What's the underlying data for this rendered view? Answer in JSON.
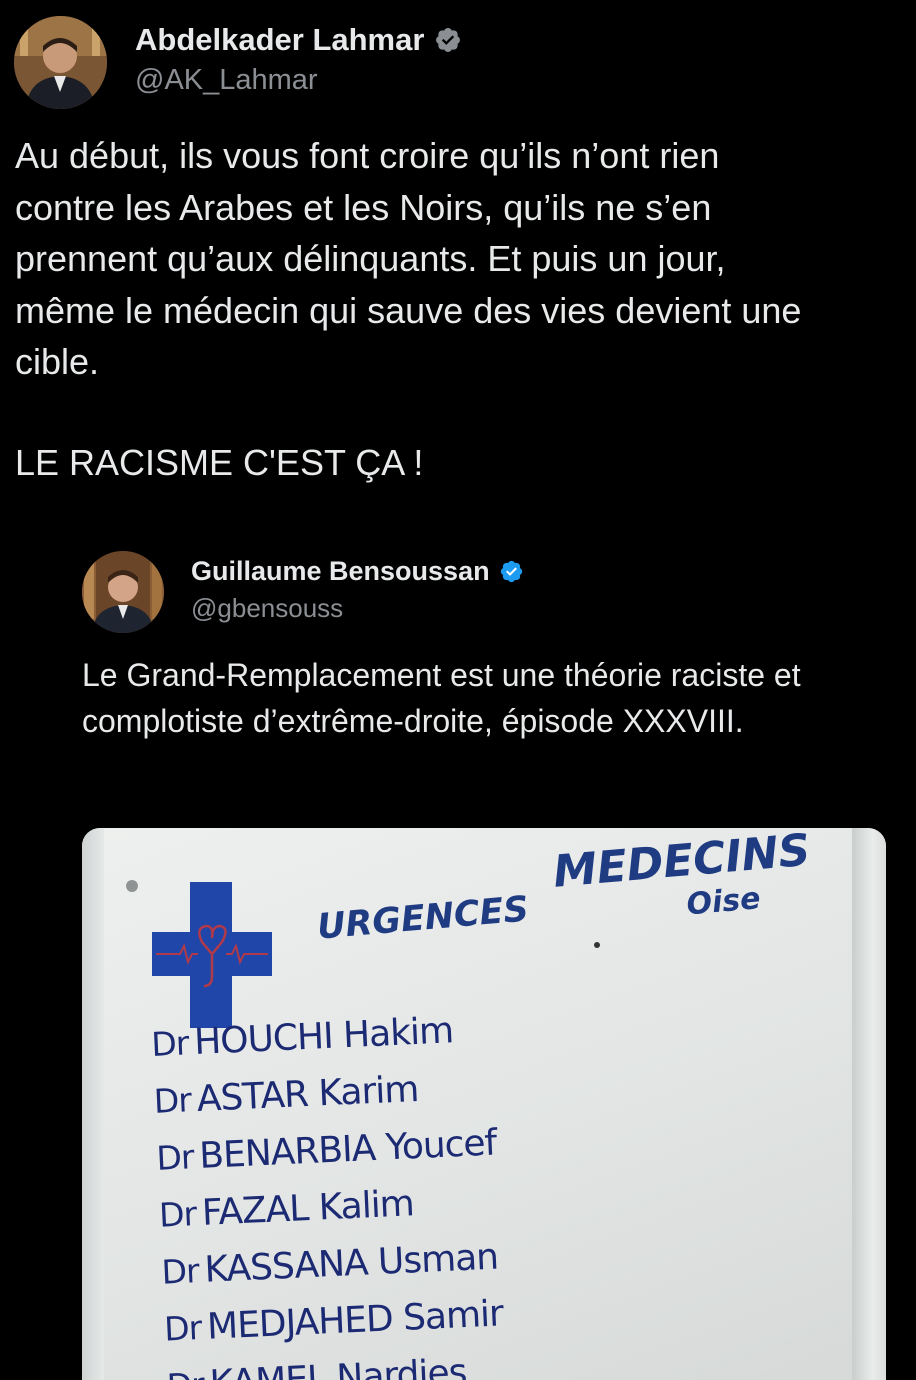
{
  "main_tweet": {
    "author_name": "Abdelkader Lahmar",
    "handle": "@AK_Lahmar",
    "verified": true,
    "text": "Au début, ils vous font croire qu’ils n’ont rien\ncontre les Arabes et les Noirs, qu’ils ne s’en\nprennent qu’aux délinquants. Et puis un jour,\nmême le médecin qui sauve des vies devient une\ncible.",
    "shout": "LE RACISME C'EST ÇA !"
  },
  "quoted_tweet": {
    "author_name": "Guillaume Bensoussan",
    "handle": "@gbensouss",
    "verified": true,
    "text": "Le Grand-Remplacement est une théorie raciste et complotiste d’extrême-droite, épisode XXXVIII."
  },
  "sign": {
    "title_left": "URGENCES",
    "title_right": "MEDECINS",
    "region": "Oise",
    "doctors": [
      {
        "prefix": "Dr",
        "name": "HOUCHI Hakim"
      },
      {
        "prefix": "Dr",
        "name": "ASTAR Karim"
      },
      {
        "prefix": "Dr",
        "name": "BENARBIA Youcef"
      },
      {
        "prefix": "Dr",
        "name": "FAZAL Kalim"
      },
      {
        "prefix": "Dr",
        "name": "KASSANA Usman"
      },
      {
        "prefix": "Dr",
        "name": "MEDJAHED Samir"
      },
      {
        "prefix": "Dr",
        "name": "KAMEL Nardjes"
      }
    ]
  },
  "colors": {
    "background": "#000000",
    "text": "#e7e9ea",
    "secondary_text": "#8b8f94",
    "verified_badge": "#1d9bf0",
    "sign_blue": "#1f3b82"
  }
}
